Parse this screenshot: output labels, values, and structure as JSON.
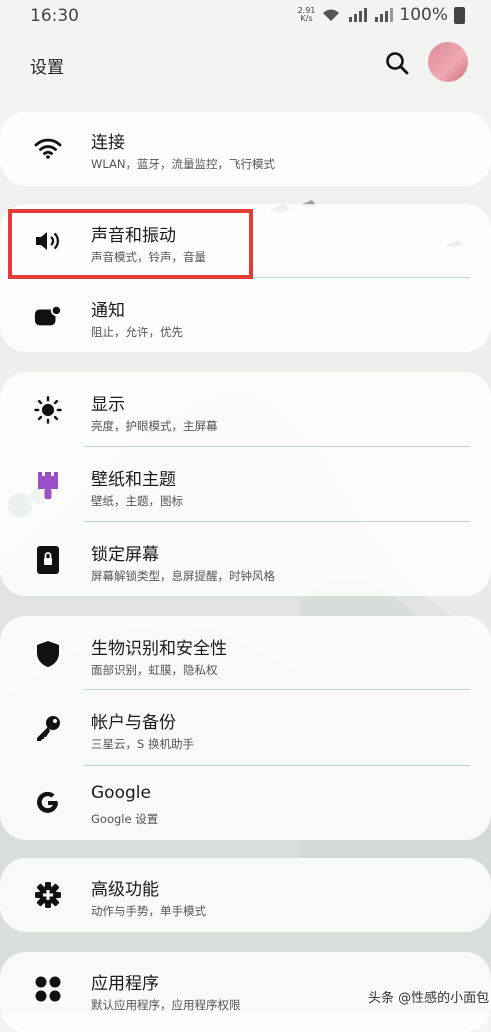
{
  "status": {
    "time": "16:30",
    "speed_value": "2.91",
    "speed_unit": "K/s",
    "battery": "100%"
  },
  "header": {
    "title": "设置"
  },
  "cards": [
    {
      "items": [
        {
          "title": "连接",
          "subtitle": "WLAN，蓝牙，流量监控，飞行模式",
          "icon": "wifi-icon"
        }
      ]
    },
    {
      "items": [
        {
          "title": "声音和振动",
          "subtitle": "声音模式，铃声，音量",
          "icon": "speaker-icon"
        },
        {
          "title": "通知",
          "subtitle": "阻止，允许，优先",
          "icon": "notification-icon"
        }
      ]
    },
    {
      "items": [
        {
          "title": "显示",
          "subtitle": "亮度，护眼模式，主屏幕",
          "icon": "brightness-icon"
        },
        {
          "title": "壁纸和主题",
          "subtitle": "壁纸，主题，图标",
          "icon": "paintbrush-icon"
        },
        {
          "title": "锁定屏幕",
          "subtitle": "屏幕解锁类型，息屏提醒，时钟风格",
          "icon": "lock-icon"
        }
      ]
    },
    {
      "items": [
        {
          "title": "生物识别和安全性",
          "subtitle": "面部识别，虹膜，隐私权",
          "icon": "shield-icon"
        },
        {
          "title": "帐户与备份",
          "subtitle": "三星云，S 换机助手",
          "icon": "key-icon"
        },
        {
          "title": "Google",
          "subtitle": "Google 设置",
          "icon": "google-icon"
        }
      ]
    },
    {
      "items": [
        {
          "title": "高级功能",
          "subtitle": "动作与手势，单手模式",
          "icon": "gear-plus-icon"
        }
      ]
    },
    {
      "items": [
        {
          "title": "应用程序",
          "subtitle": "默认应用程序，应用程序权限",
          "icon": "apps-icon"
        }
      ]
    }
  ],
  "watermark": "头条 @性感的小面包",
  "colors": {
    "highlight": "#e33a3a",
    "wallpaper_icon": "#9b4fc7",
    "divider": "#bfd4cf"
  }
}
